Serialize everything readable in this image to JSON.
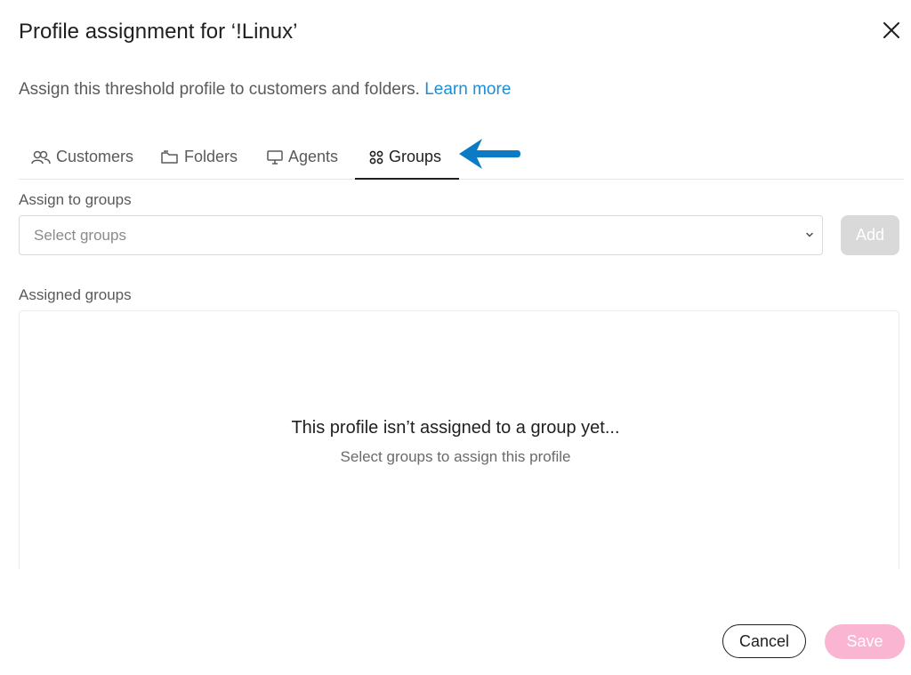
{
  "dialog": {
    "title": "Profile assignment for ‘!Linux’",
    "subtitle": "Assign this threshold profile to customers and folders.",
    "learn_more": "Learn more"
  },
  "tabs": [
    {
      "label": "Customers",
      "icon": "users-icon"
    },
    {
      "label": "Folders",
      "icon": "folder-icon"
    },
    {
      "label": "Agents",
      "icon": "monitor-icon"
    },
    {
      "label": "Groups",
      "icon": "groups-icon",
      "active": true
    }
  ],
  "assign": {
    "label": "Assign to groups",
    "placeholder": "Select groups",
    "add_label": "Add"
  },
  "assigned": {
    "label": "Assigned groups",
    "empty_title": "This profile isn’t assigned to a group yet...",
    "empty_subtitle": "Select groups to assign this profile"
  },
  "footer": {
    "cancel_label": "Cancel",
    "save_label": "Save"
  },
  "colors": {
    "link": "#1a8fd6",
    "save_disabled": "#fab5d2",
    "add_disabled": "#d9d9d9",
    "annotation_arrow": "#0b7bc6"
  }
}
